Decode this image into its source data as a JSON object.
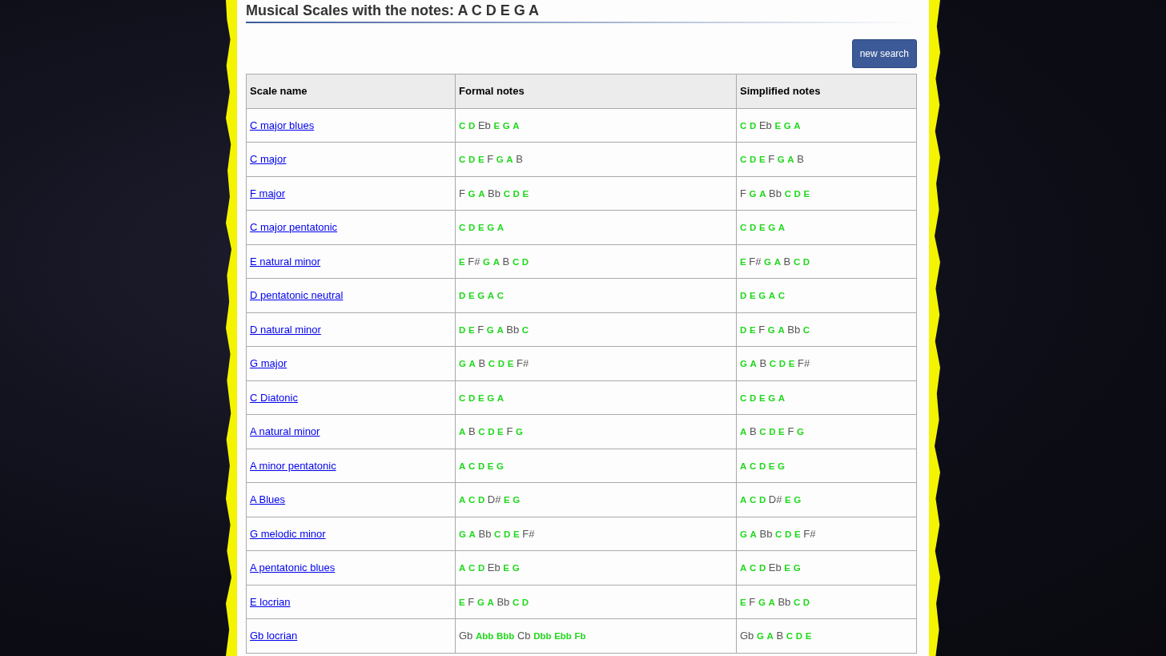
{
  "title": "Musical Scales with the notes: A C D E G A",
  "new_search_button": "new search",
  "table": {
    "columns": [
      "Scale name",
      "Formal notes",
      "Simplified notes"
    ],
    "rows": [
      {
        "name": "C major blues",
        "formal": [
          {
            "note": "C",
            "matched": true
          },
          {
            "note": "D",
            "matched": true
          },
          {
            "note": "Eb",
            "matched": false
          },
          {
            "note": "E",
            "matched": true
          },
          {
            "note": "G",
            "matched": true
          },
          {
            "note": "A",
            "matched": true
          }
        ],
        "simplified": [
          {
            "note": "C",
            "matched": true
          },
          {
            "note": "D",
            "matched": true
          },
          {
            "note": "Eb",
            "matched": false
          },
          {
            "note": "E",
            "matched": true
          },
          {
            "note": "G",
            "matched": true
          },
          {
            "note": "A",
            "matched": true
          }
        ]
      },
      {
        "name": "C major",
        "formal": [
          {
            "note": "C",
            "matched": true
          },
          {
            "note": "D",
            "matched": true
          },
          {
            "note": "E",
            "matched": true
          },
          {
            "note": "F",
            "matched": false
          },
          {
            "note": "G",
            "matched": true
          },
          {
            "note": "A",
            "matched": true
          },
          {
            "note": "B",
            "matched": false
          }
        ],
        "simplified": [
          {
            "note": "C",
            "matched": true
          },
          {
            "note": "D",
            "matched": true
          },
          {
            "note": "E",
            "matched": true
          },
          {
            "note": "F",
            "matched": false
          },
          {
            "note": "G",
            "matched": true
          },
          {
            "note": "A",
            "matched": true
          },
          {
            "note": "B",
            "matched": false
          }
        ]
      },
      {
        "name": "F major",
        "formal": [
          {
            "note": "F",
            "matched": false
          },
          {
            "note": "G",
            "matched": true
          },
          {
            "note": "A",
            "matched": true
          },
          {
            "note": "Bb",
            "matched": false
          },
          {
            "note": "C",
            "matched": true
          },
          {
            "note": "D",
            "matched": true
          },
          {
            "note": "E",
            "matched": true
          }
        ],
        "simplified": [
          {
            "note": "F",
            "matched": false
          },
          {
            "note": "G",
            "matched": true
          },
          {
            "note": "A",
            "matched": true
          },
          {
            "note": "Bb",
            "matched": false
          },
          {
            "note": "C",
            "matched": true
          },
          {
            "note": "D",
            "matched": true
          },
          {
            "note": "E",
            "matched": true
          }
        ]
      },
      {
        "name": "C major pentatonic",
        "formal": [
          {
            "note": "C",
            "matched": true
          },
          {
            "note": "D",
            "matched": true
          },
          {
            "note": "E",
            "matched": true
          },
          {
            "note": "G",
            "matched": true
          },
          {
            "note": "A",
            "matched": true
          }
        ],
        "simplified": [
          {
            "note": "C",
            "matched": true
          },
          {
            "note": "D",
            "matched": true
          },
          {
            "note": "E",
            "matched": true
          },
          {
            "note": "G",
            "matched": true
          },
          {
            "note": "A",
            "matched": true
          }
        ]
      },
      {
        "name": "E natural minor",
        "formal": [
          {
            "note": "E",
            "matched": true
          },
          {
            "note": "F#",
            "matched": false
          },
          {
            "note": "G",
            "matched": true
          },
          {
            "note": "A",
            "matched": true
          },
          {
            "note": "B",
            "matched": false
          },
          {
            "note": "C",
            "matched": true
          },
          {
            "note": "D",
            "matched": true
          }
        ],
        "simplified": [
          {
            "note": "E",
            "matched": true
          },
          {
            "note": "F#",
            "matched": false
          },
          {
            "note": "G",
            "matched": true
          },
          {
            "note": "A",
            "matched": true
          },
          {
            "note": "B",
            "matched": false
          },
          {
            "note": "C",
            "matched": true
          },
          {
            "note": "D",
            "matched": true
          }
        ]
      },
      {
        "name": "D pentatonic neutral",
        "formal": [
          {
            "note": "D",
            "matched": true
          },
          {
            "note": "E",
            "matched": true
          },
          {
            "note": "G",
            "matched": true
          },
          {
            "note": "A",
            "matched": true
          },
          {
            "note": "C",
            "matched": true
          }
        ],
        "simplified": [
          {
            "note": "D",
            "matched": true
          },
          {
            "note": "E",
            "matched": true
          },
          {
            "note": "G",
            "matched": true
          },
          {
            "note": "A",
            "matched": true
          },
          {
            "note": "C",
            "matched": true
          }
        ]
      },
      {
        "name": "D natural minor",
        "formal": [
          {
            "note": "D",
            "matched": true
          },
          {
            "note": "E",
            "matched": true
          },
          {
            "note": "F",
            "matched": false
          },
          {
            "note": "G",
            "matched": true
          },
          {
            "note": "A",
            "matched": true
          },
          {
            "note": "Bb",
            "matched": false
          },
          {
            "note": "C",
            "matched": true
          }
        ],
        "simplified": [
          {
            "note": "D",
            "matched": true
          },
          {
            "note": "E",
            "matched": true
          },
          {
            "note": "F",
            "matched": false
          },
          {
            "note": "G",
            "matched": true
          },
          {
            "note": "A",
            "matched": true
          },
          {
            "note": "Bb",
            "matched": false
          },
          {
            "note": "C",
            "matched": true
          }
        ]
      },
      {
        "name": "G major",
        "formal": [
          {
            "note": "G",
            "matched": true
          },
          {
            "note": "A",
            "matched": true
          },
          {
            "note": "B",
            "matched": false
          },
          {
            "note": "C",
            "matched": true
          },
          {
            "note": "D",
            "matched": true
          },
          {
            "note": "E",
            "matched": true
          },
          {
            "note": "F#",
            "matched": false
          }
        ],
        "simplified": [
          {
            "note": "G",
            "matched": true
          },
          {
            "note": "A",
            "matched": true
          },
          {
            "note": "B",
            "matched": false
          },
          {
            "note": "C",
            "matched": true
          },
          {
            "note": "D",
            "matched": true
          },
          {
            "note": "E",
            "matched": true
          },
          {
            "note": "F#",
            "matched": false
          }
        ]
      },
      {
        "name": "C Diatonic",
        "formal": [
          {
            "note": "C",
            "matched": true
          },
          {
            "note": "D",
            "matched": true
          },
          {
            "note": "E",
            "matched": true
          },
          {
            "note": "G",
            "matched": true
          },
          {
            "note": "A",
            "matched": true
          }
        ],
        "simplified": [
          {
            "note": "C",
            "matched": true
          },
          {
            "note": "D",
            "matched": true
          },
          {
            "note": "E",
            "matched": true
          },
          {
            "note": "G",
            "matched": true
          },
          {
            "note": "A",
            "matched": true
          }
        ]
      },
      {
        "name": "A natural minor",
        "formal": [
          {
            "note": "A",
            "matched": true
          },
          {
            "note": "B",
            "matched": false
          },
          {
            "note": "C",
            "matched": true
          },
          {
            "note": "D",
            "matched": true
          },
          {
            "note": "E",
            "matched": true
          },
          {
            "note": "F",
            "matched": false
          },
          {
            "note": "G",
            "matched": true
          }
        ],
        "simplified": [
          {
            "note": "A",
            "matched": true
          },
          {
            "note": "B",
            "matched": false
          },
          {
            "note": "C",
            "matched": true
          },
          {
            "note": "D",
            "matched": true
          },
          {
            "note": "E",
            "matched": true
          },
          {
            "note": "F",
            "matched": false
          },
          {
            "note": "G",
            "matched": true
          }
        ]
      },
      {
        "name": "A minor pentatonic",
        "formal": [
          {
            "note": "A",
            "matched": true
          },
          {
            "note": "C",
            "matched": true
          },
          {
            "note": "D",
            "matched": true
          },
          {
            "note": "E",
            "matched": true
          },
          {
            "note": "G",
            "matched": true
          }
        ],
        "simplified": [
          {
            "note": "A",
            "matched": true
          },
          {
            "note": "C",
            "matched": true
          },
          {
            "note": "D",
            "matched": true
          },
          {
            "note": "E",
            "matched": true
          },
          {
            "note": "G",
            "matched": true
          }
        ]
      },
      {
        "name": "A Blues",
        "formal": [
          {
            "note": "A",
            "matched": true
          },
          {
            "note": "C",
            "matched": true
          },
          {
            "note": "D",
            "matched": true
          },
          {
            "note": "D#",
            "matched": false
          },
          {
            "note": "E",
            "matched": true
          },
          {
            "note": "G",
            "matched": true
          }
        ],
        "simplified": [
          {
            "note": "A",
            "matched": true
          },
          {
            "note": "C",
            "matched": true
          },
          {
            "note": "D",
            "matched": true
          },
          {
            "note": "D#",
            "matched": false
          },
          {
            "note": "E",
            "matched": true
          },
          {
            "note": "G",
            "matched": true
          }
        ]
      },
      {
        "name": "G melodic minor",
        "formal": [
          {
            "note": "G",
            "matched": true
          },
          {
            "note": "A",
            "matched": true
          },
          {
            "note": "Bb",
            "matched": false
          },
          {
            "note": "C",
            "matched": true
          },
          {
            "note": "D",
            "matched": true
          },
          {
            "note": "E",
            "matched": true
          },
          {
            "note": "F#",
            "matched": false
          }
        ],
        "simplified": [
          {
            "note": "G",
            "matched": true
          },
          {
            "note": "A",
            "matched": true
          },
          {
            "note": "Bb",
            "matched": false
          },
          {
            "note": "C",
            "matched": true
          },
          {
            "note": "D",
            "matched": true
          },
          {
            "note": "E",
            "matched": true
          },
          {
            "note": "F#",
            "matched": false
          }
        ]
      },
      {
        "name": "A pentatonic blues",
        "formal": [
          {
            "note": "A",
            "matched": true
          },
          {
            "note": "C",
            "matched": true
          },
          {
            "note": "D",
            "matched": true
          },
          {
            "note": "Eb",
            "matched": false
          },
          {
            "note": "E",
            "matched": true
          },
          {
            "note": "G",
            "matched": true
          }
        ],
        "simplified": [
          {
            "note": "A",
            "matched": true
          },
          {
            "note": "C",
            "matched": true
          },
          {
            "note": "D",
            "matched": true
          },
          {
            "note": "Eb",
            "matched": false
          },
          {
            "note": "E",
            "matched": true
          },
          {
            "note": "G",
            "matched": true
          }
        ]
      },
      {
        "name": "E locrian",
        "formal": [
          {
            "note": "E",
            "matched": true
          },
          {
            "note": "F",
            "matched": false
          },
          {
            "note": "G",
            "matched": true
          },
          {
            "note": "A",
            "matched": true
          },
          {
            "note": "Bb",
            "matched": false
          },
          {
            "note": "C",
            "matched": true
          },
          {
            "note": "D",
            "matched": true
          }
        ],
        "simplified": [
          {
            "note": "E",
            "matched": true
          },
          {
            "note": "F",
            "matched": false
          },
          {
            "note": "G",
            "matched": true
          },
          {
            "note": "A",
            "matched": true
          },
          {
            "note": "Bb",
            "matched": false
          },
          {
            "note": "C",
            "matched": true
          },
          {
            "note": "D",
            "matched": true
          }
        ]
      },
      {
        "name": "Gb locrian",
        "formal": [
          {
            "note": "Gb",
            "matched": false
          },
          {
            "note": "Abb",
            "matched": true
          },
          {
            "note": "Bbb",
            "matched": true
          },
          {
            "note": "Cb",
            "matched": false
          },
          {
            "note": "Dbb",
            "matched": true
          },
          {
            "note": "Ebb",
            "matched": true
          },
          {
            "note": "Fb",
            "matched": true
          }
        ],
        "simplified": [
          {
            "note": "Gb",
            "matched": false
          },
          {
            "note": "G",
            "matched": true
          },
          {
            "note": "A",
            "matched": true
          },
          {
            "note": "B",
            "matched": false
          },
          {
            "note": "C",
            "matched": true
          },
          {
            "note": "D",
            "matched": true
          },
          {
            "note": "E",
            "matched": true
          }
        ]
      }
    ]
  }
}
